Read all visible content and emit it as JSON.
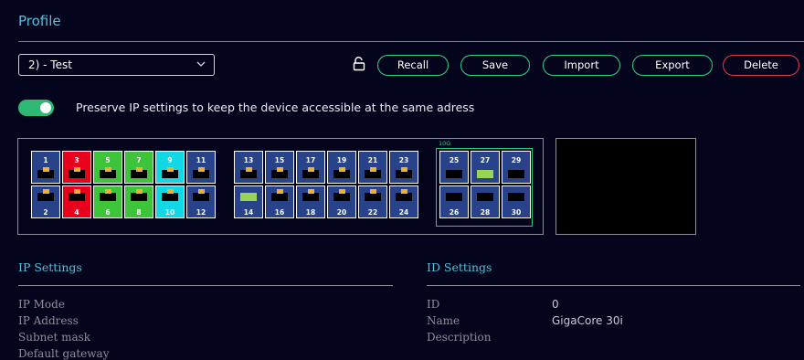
{
  "header": {
    "title": "Profile"
  },
  "profile_select": {
    "value": "2) - Test"
  },
  "buttons": {
    "recall": "Recall",
    "save": "Save",
    "import": "Import",
    "export": "Export",
    "delete": "Delete"
  },
  "preserve": {
    "label": "Preserve IP settings to keep the device accessible at the same adress",
    "enabled": true
  },
  "ports": {
    "ten_g_label": "10G",
    "group1": [
      {
        "top": "1",
        "bottom": "2",
        "top_color": "#29438b",
        "bottom_color": "#29438b"
      },
      {
        "top": "3",
        "bottom": "4",
        "top_color": "#e8001c",
        "bottom_color": "#e8001c"
      },
      {
        "top": "5",
        "bottom": "6",
        "top_color": "#3ec43a",
        "bottom_color": "#3ec43a"
      },
      {
        "top": "7",
        "bottom": "8",
        "top_color": "#3ec43a",
        "bottom_color": "#3ec43a"
      },
      {
        "top": "9",
        "bottom": "10",
        "top_color": "#12d8e6",
        "bottom_color": "#12d8e6"
      },
      {
        "top": "11",
        "bottom": "12",
        "top_color": "#29438b",
        "bottom_color": "#29438b"
      }
    ],
    "group2": [
      {
        "top": "13",
        "bottom": "14",
        "top_color": "#29438b",
        "bottom_color": "#29438b",
        "bottom_hole": "#9ad454"
      },
      {
        "top": "15",
        "bottom": "16",
        "top_color": "#29438b",
        "bottom_color": "#29438b"
      },
      {
        "top": "17",
        "bottom": "18",
        "top_color": "#29438b",
        "bottom_color": "#29438b"
      },
      {
        "top": "19",
        "bottom": "20",
        "top_color": "#29438b",
        "bottom_color": "#29438b"
      },
      {
        "top": "21",
        "bottom": "22",
        "top_color": "#29438b",
        "bottom_color": "#29438b"
      },
      {
        "top": "23",
        "bottom": "24",
        "top_color": "#29438b",
        "bottom_color": "#29438b"
      }
    ],
    "group3": [
      {
        "top": "25",
        "bottom": "26"
      },
      {
        "top": "27",
        "bottom": "28",
        "top_hole": "#9ad454"
      },
      {
        "top": "29",
        "bottom": "30"
      }
    ]
  },
  "ip_settings": {
    "title": "IP Settings",
    "rows": [
      "IP Mode",
      "IP Address",
      "Subnet mask",
      "Default gateway"
    ]
  },
  "id_settings": {
    "title": "ID Settings",
    "rows": [
      {
        "label": "ID",
        "value": "0"
      },
      {
        "label": "Name",
        "value": "GigaCore 30i"
      },
      {
        "label": "Description",
        "value": ""
      }
    ]
  }
}
